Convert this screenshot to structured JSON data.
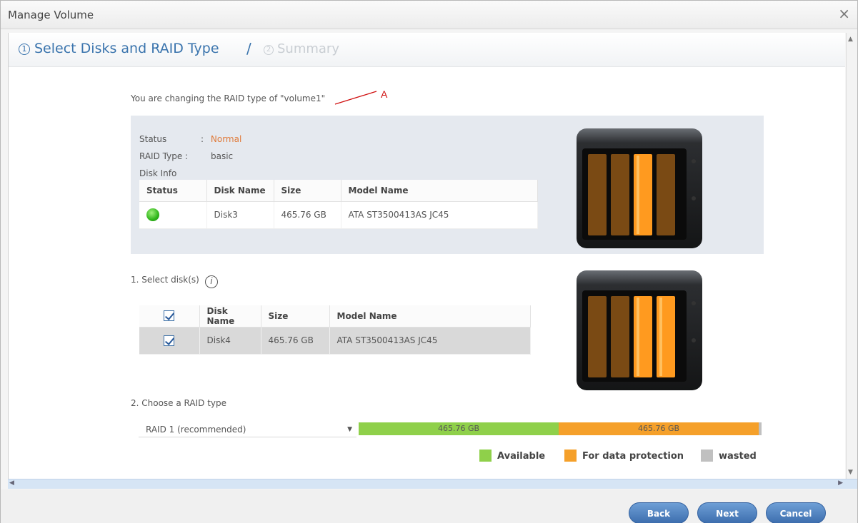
{
  "window": {
    "title": "Manage Volume",
    "close_icon": "close-icon"
  },
  "steps": {
    "step1_num": "1",
    "step1_label": "Select Disks and RAID Type",
    "separator": "/",
    "step2_num": "2",
    "step2_label": "Summary"
  },
  "annotation": {
    "label": "A"
  },
  "intro": "You are changing the RAID type of \"volume1\"",
  "volume_info": {
    "status_label": "Status",
    "status_sep": ":",
    "status_value": "Normal",
    "raid_label": "RAID Type :",
    "raid_value": "basic",
    "disk_info_label": "Disk Info",
    "table": {
      "headers": [
        "Status",
        "Disk Name",
        "Size",
        "Model Name"
      ],
      "rows": [
        {
          "disk": "Disk3",
          "size": "465.76 GB",
          "model": "ATA ST3500413AS JC45"
        }
      ]
    }
  },
  "select_disks": {
    "title": "1. Select disk(s)",
    "info_icon": "i",
    "table": {
      "headers": [
        "Disk Name",
        "Size",
        "Model Name"
      ],
      "rows": [
        {
          "disk": "Disk4",
          "size": "465.76 GB",
          "model": "ATA ST3500413AS JC45"
        }
      ]
    }
  },
  "raid": {
    "title": "2. Choose a RAID type",
    "selected": "RAID 1  (recommended)",
    "capacity": {
      "available_label": "465.76 GB",
      "protection_label": "465.76 GB",
      "available_fraction": 0.497,
      "protection_fraction": 0.497,
      "wasted_fraction": 0.006
    },
    "legend": {
      "available": "Available",
      "protection": "For data protection",
      "wasted": "wasted"
    }
  },
  "colors": {
    "accent": "#3a74ad",
    "available": "#8fd04a",
    "protection": "#f5a02a",
    "wasted": "#c0c0c0",
    "status_normal": "#e07b3b"
  },
  "footer": {
    "back": "Back",
    "next": "Next",
    "cancel": "Cancel"
  }
}
